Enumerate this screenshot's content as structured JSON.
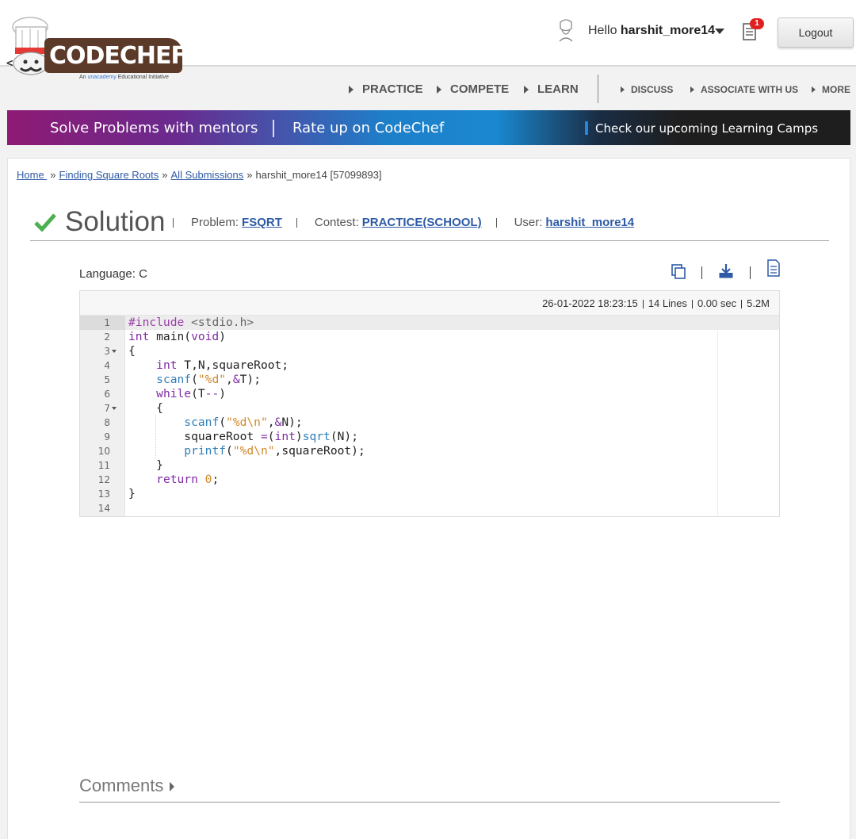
{
  "brand": {
    "name": "CODECHEF",
    "tagline_prefix": "An ",
    "tagline_brand": "unacademy",
    "tagline_suffix": " Educational Initiative"
  },
  "user": {
    "greeting": "Hello ",
    "username": "harshit_more14",
    "notification_count": "1",
    "logout_label": "Logout"
  },
  "nav": {
    "primary": [
      "PRACTICE",
      "COMPETE",
      "LEARN"
    ],
    "secondary": [
      "DISCUSS",
      "ASSOCIATE WITH US",
      "MORE"
    ]
  },
  "banner": {
    "left": "Solve Problems with mentors",
    "middle": "Rate up on CodeChef",
    "right": "Check our upcoming Learning Camps"
  },
  "breadcrumb": {
    "home": "Home ",
    "problem": "Finding Square Roots",
    "submissions": "All Submissions",
    "current": "harshit_more14 [57099893]",
    "separator": "»"
  },
  "solution": {
    "title": "Solution",
    "problem_label": "Problem:",
    "problem_code": "FSQRT",
    "contest_label": "Contest:",
    "contest_name": "PRACTICE(SCHOOL)",
    "user_label": "User:",
    "user_name": "harshit_more14",
    "status_icon": "check-icon",
    "status_color": "#4caf50"
  },
  "language": "Language: C",
  "tools": [
    "copy-icon",
    "download-icon",
    "document-icon"
  ],
  "code_meta": {
    "date": "26-01-2022 18:23:15",
    "lines": "14 Lines",
    "time": "0.00 sec",
    "memory": "5.2M"
  },
  "code": {
    "line_numbers": [
      "1",
      "2",
      "3",
      "4",
      "5",
      "6",
      "7",
      "8",
      "9",
      "10",
      "11",
      "12",
      "13",
      "14"
    ],
    "lines": [
      "#include <stdio.h>",
      "int main(void)",
      "{",
      "    int T,N,squareRoot;",
      "    scanf(\"%d\",&T);",
      "    while(T--)",
      "    {",
      "        scanf(\"%d\\n\",&N);",
      "        squareRoot =(int)sqrt(N);",
      "        printf(\"%d\\n\",squareRoot);",
      "    }",
      "    return 0;",
      "}",
      ""
    ]
  },
  "comments": {
    "label": "Comments"
  },
  "colors": {
    "link": "#2e5aa6",
    "keyword": "#7f2aa3",
    "function": "#2f7fb8",
    "string": "#d2882c",
    "badge": "#e02020"
  }
}
